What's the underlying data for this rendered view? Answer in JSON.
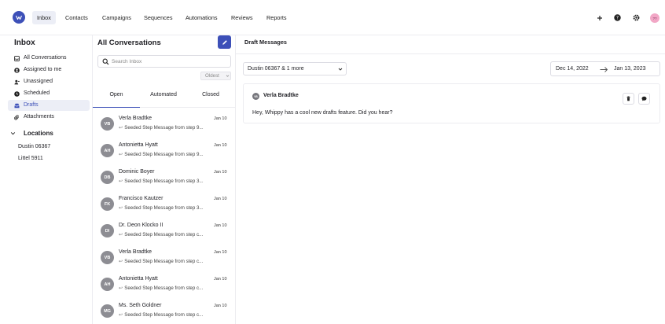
{
  "nav": {
    "items": [
      {
        "label": "Inbox",
        "active": true
      },
      {
        "label": "Contacts"
      },
      {
        "label": "Campaigns"
      },
      {
        "label": "Sequences"
      },
      {
        "label": "Automations"
      },
      {
        "label": "Reviews"
      },
      {
        "label": "Reports"
      }
    ],
    "user_initials": "??"
  },
  "sidebar": {
    "title": "Inbox",
    "items": [
      {
        "label": "All Conversations",
        "icon": "inbox-icon"
      },
      {
        "label": "Assigned to me",
        "icon": "user-circle-icon"
      },
      {
        "label": "Unassigned",
        "icon": "user-minus-icon"
      },
      {
        "label": "Scheduled",
        "icon": "clock-icon"
      },
      {
        "label": "Drafts",
        "icon": "drafts-icon",
        "active": true
      },
      {
        "label": "Attachments",
        "icon": "paperclip-icon"
      }
    ],
    "locations_label": "Locations",
    "locations": [
      "Dustin 06367",
      "Littel 5911"
    ]
  },
  "conversations": {
    "title": "All Conversations",
    "search_placeholder": "Search Inbox",
    "sort": "Oldest",
    "tabs": [
      {
        "label": "Open",
        "active": true
      },
      {
        "label": "Automated"
      },
      {
        "label": "Closed"
      }
    ],
    "rows": [
      {
        "initials": "VB",
        "name": "Verla Bradtke",
        "date": "Jan 10",
        "preview": "Seeded Step Message from step 9..."
      },
      {
        "initials": "AH",
        "name": "Antonietta Hyatt",
        "date": "Jan 10",
        "preview": "Seeded Step Message from step 9..."
      },
      {
        "initials": "DB",
        "name": "Dominic Boyer",
        "date": "Jan 10",
        "preview": "Seeded Step Message from step 3..."
      },
      {
        "initials": "FK",
        "name": "Francisco Kautzer",
        "date": "Jan 10",
        "preview": "Seeded Step Message from step 3..."
      },
      {
        "initials": "DI",
        "name": "Dr. Deon Klocko II",
        "date": "Jan 10",
        "preview": "Seeded Step Message from step c..."
      },
      {
        "initials": "VB",
        "name": "Verla Bradtke",
        "date": "Jan 10",
        "preview": "Seeded Step Message from step c..."
      },
      {
        "initials": "AH",
        "name": "Antonietta Hyatt",
        "date": "Jan 10",
        "preview": "Seeded Step Message from step c..."
      },
      {
        "initials": "MG",
        "name": "Ms. Seth Goldner",
        "date": "Jan 10",
        "preview": "Seeded Step Message from step c..."
      }
    ]
  },
  "main": {
    "title": "Draft Messages",
    "location_filter": "Dustin 06367 & 1 more",
    "date_from": "Dec 14, 2022",
    "date_to": "Jan 13, 2023",
    "draft": {
      "initials": "VB",
      "name": "Verla Bradtke",
      "message": "Hey, Whippy has a cool new drafts feature. Did you hear?"
    }
  },
  "colors": {
    "accent": "#3d50b8",
    "avatar": "#8d8d93"
  }
}
